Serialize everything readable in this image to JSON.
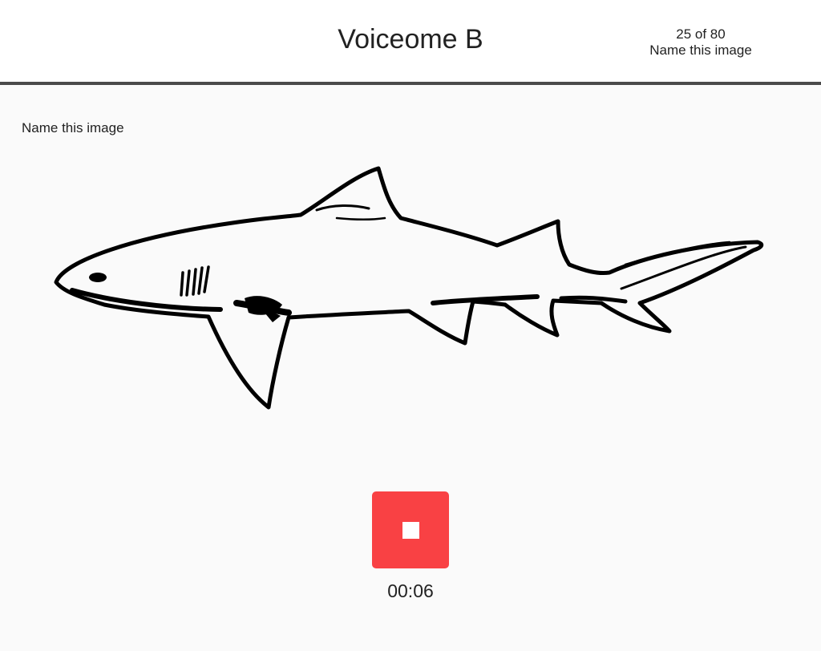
{
  "header": {
    "title": "Voiceome B",
    "progress_text": "25 of 80",
    "task_subtitle": "Name this image"
  },
  "task": {
    "prompt": "Name this image",
    "image_icon": "shark-illustration"
  },
  "recorder": {
    "button_icon": "stop-icon",
    "button_color": "#f94144",
    "elapsed": "00:06"
  }
}
